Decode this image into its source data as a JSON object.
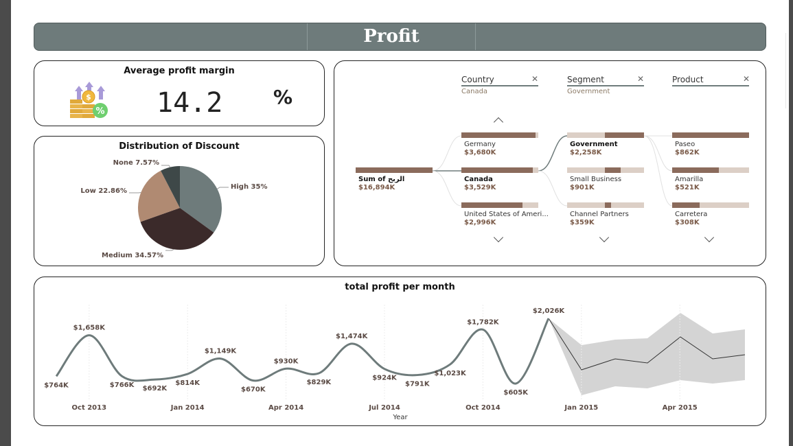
{
  "header": {
    "title": "Profit"
  },
  "kpi": {
    "title": "Average profit margin",
    "value": "14.2",
    "unit": "%",
    "icon": "coins-profit-icon"
  },
  "discount": {
    "title": "Distribution of Discount",
    "slices": [
      {
        "label": "High 35%",
        "value": 35,
        "color": "#6e7b7b"
      },
      {
        "label": "Medium 34.57%",
        "value": 34.57,
        "color": "#3b2a2a"
      },
      {
        "label": "Low 22.86%",
        "value": 22.86,
        "color": "#b08a72"
      },
      {
        "label": "None 7.57%",
        "value": 7.57,
        "color": "#3e4848"
      }
    ]
  },
  "decomp": {
    "columns": [
      {
        "header": "Country",
        "sub": "Canada"
      },
      {
        "header": "Segment",
        "sub": "Government"
      },
      {
        "header": "Product",
        "sub": ""
      }
    ],
    "root": {
      "label": "Sum of الربح",
      "value": "$16,894K"
    },
    "country": [
      {
        "label": "Germany",
        "value": "$3,680K"
      },
      {
        "label": "Canada",
        "value": "$3,529K"
      },
      {
        "label": "United States of Ameri...",
        "value": "$2,996K"
      }
    ],
    "segment": [
      {
        "label": "Government",
        "value": "$2,258K"
      },
      {
        "label": "Small Business",
        "value": "$901K"
      },
      {
        "label": "Channel Partners",
        "value": "$359K"
      }
    ],
    "product": [
      {
        "label": "Paseo",
        "value": "$862K"
      },
      {
        "label": "Amarilla",
        "value": "$521K"
      },
      {
        "label": "Carretera",
        "value": "$308K"
      }
    ]
  },
  "trend": {
    "title": "total profit per month",
    "xlabel": "Year",
    "ticks": [
      "Oct 2013",
      "Jan 2014",
      "Apr 2014",
      "Jul 2014",
      "Oct 2014",
      "Jan 2015",
      "Apr 2015"
    ]
  },
  "chart_data": {
    "type": "line",
    "title": "total profit per month",
    "xlabel": "Year",
    "ylabel": "",
    "grid": false,
    "x": [
      "Sep 2013",
      "Oct 2013",
      "Nov 2013",
      "Dec 2013",
      "Jan 2014",
      "Feb 2014",
      "Mar 2014",
      "Apr 2014",
      "May 2014",
      "Jun 2014",
      "Jul 2014",
      "Aug 2014",
      "Sep 2014",
      "Oct 2014",
      "Nov 2014",
      "Dec 2014"
    ],
    "series": [
      {
        "values": [
          764,
          1658,
          766,
          692,
          814,
          1149,
          670,
          930,
          829,
          1474,
          924,
          791,
          1023,
          1782,
          605,
          2026
        ],
        "labels": [
          "$764K",
          "$1,658K",
          "$766K",
          "$692K",
          "$814K",
          "$1,149K",
          "$670K",
          "$930K",
          "$829K",
          "$1,474K",
          "$924K",
          "$791K",
          "$1,023K",
          "$1,782K",
          "$605K",
          "$2,026K"
        ]
      }
    ]
  }
}
